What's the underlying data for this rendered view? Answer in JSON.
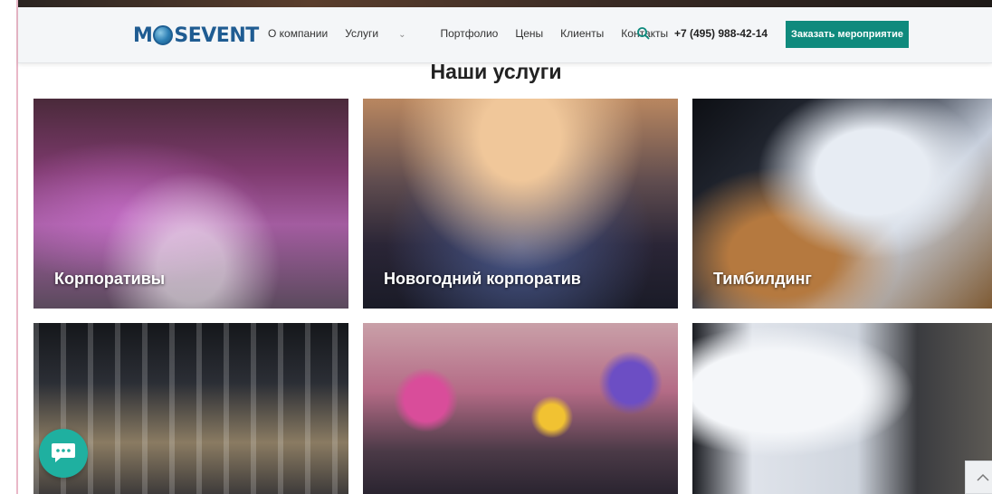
{
  "header": {
    "logo": {
      "part1": "M",
      "part2": "SEVENT"
    },
    "nav": [
      {
        "label": "О компании"
      },
      {
        "label": "Услуги",
        "has_dropdown": true
      },
      {
        "label": "Портфолио"
      },
      {
        "label": "Цены"
      },
      {
        "label": "Клиенты"
      },
      {
        "label": "Контакты"
      }
    ],
    "search_icon": "search-icon",
    "phone": "+7 (495) 988-42-14",
    "cta_label": "Заказать мероприятие",
    "colors": {
      "brand": "#1f5c92",
      "accent": "#0f8a7d"
    }
  },
  "services": {
    "title": "Наши услуги",
    "cards": [
      {
        "caption": "Корпоративы"
      },
      {
        "caption": "Новогодний корпоратив"
      },
      {
        "caption": "Тимбилдинг"
      },
      {
        "caption": ""
      },
      {
        "caption": ""
      },
      {
        "caption": ""
      }
    ]
  },
  "widgets": {
    "chat_icon": "chat-bubble-icon",
    "scroll_top_icon": "chevron-up-icon",
    "chat_color": "#1fb0a0"
  }
}
